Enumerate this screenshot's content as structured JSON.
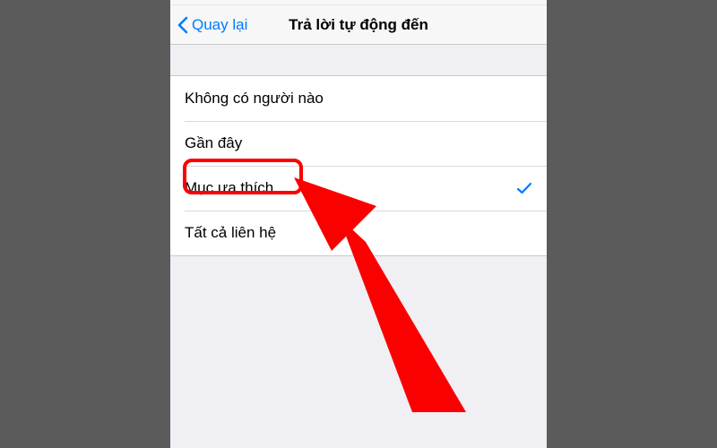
{
  "nav": {
    "back_label": "Quay lại",
    "title": "Trả lời tự động đến"
  },
  "options": [
    {
      "label": "Không có người nào",
      "selected": false
    },
    {
      "label": "Gần đây",
      "selected": false
    },
    {
      "label": "Mục ưa thích",
      "selected": true
    },
    {
      "label": "Tất cả liên hệ",
      "selected": false
    }
  ],
  "annotation": {
    "highlight_target": "Mục ưa thích",
    "arrow_color": "#fa0000"
  }
}
